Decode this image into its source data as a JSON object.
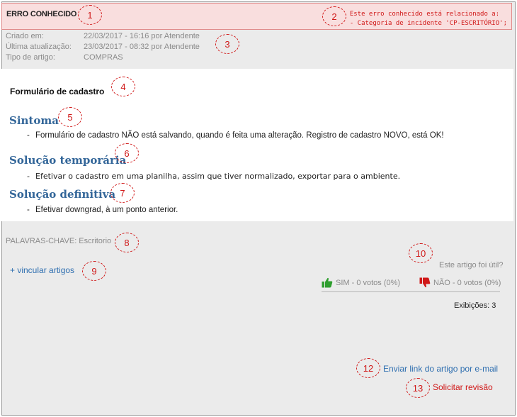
{
  "header": {
    "title": "ERRO CONHECIDO",
    "relation_line1": "Este erro conhecido está relacionado a:",
    "relation_line2": "- Categoria de incidente 'CP-ESCRITÓRIO';"
  },
  "meta": {
    "created_label": "Criado em:",
    "created_value": "22/03/2017 - 16:16 por Atendente",
    "updated_label": "Última atualização:",
    "updated_value": "23/03/2017 - 08:32 por Atendente",
    "type_label": "Tipo de artigo:",
    "type_value": "COMPRAS"
  },
  "article": {
    "title": "Formulário de cadastro",
    "symptom_title": "Sintoma",
    "symptom_text": "Formulário de cadastro NÃO está salvando, quando é feita uma alteração. Registro de cadastro NOVO, está OK!",
    "temp_title": "Solução temporária",
    "temp_text": "Efetivar o cadastro em uma planilha, assim que tiver normalizado, exportar para o ambiente.",
    "final_title": "Solução definitiva",
    "final_text": "Efetivar downgrad, à um ponto anterior."
  },
  "footer": {
    "keywords": "PALAVRAS-CHAVE: Escritorio",
    "link_articles": "+ vincular artigos",
    "useful_question": "Este artigo foi útil?",
    "vote_yes": "SIM - 0 votos (0%)",
    "vote_no": "NÃO - 0 votos (0%)",
    "views": "Exibições: 3",
    "email_link": "Enviar link do artigo por e-mail",
    "review_link": "Solicitar revisão"
  },
  "callouts": [
    "1",
    "2",
    "3",
    "4",
    "5",
    "6",
    "7",
    "8",
    "9",
    "10",
    "12",
    "13"
  ],
  "colors": {
    "accent_blue": "#336699",
    "alert_red": "#d01818",
    "thumb_up": "#2e9e2e",
    "thumb_down": "#d01818"
  },
  "icons": {
    "vote_yes": "thumbs-up-icon",
    "vote_no": "thumbs-down-icon"
  }
}
